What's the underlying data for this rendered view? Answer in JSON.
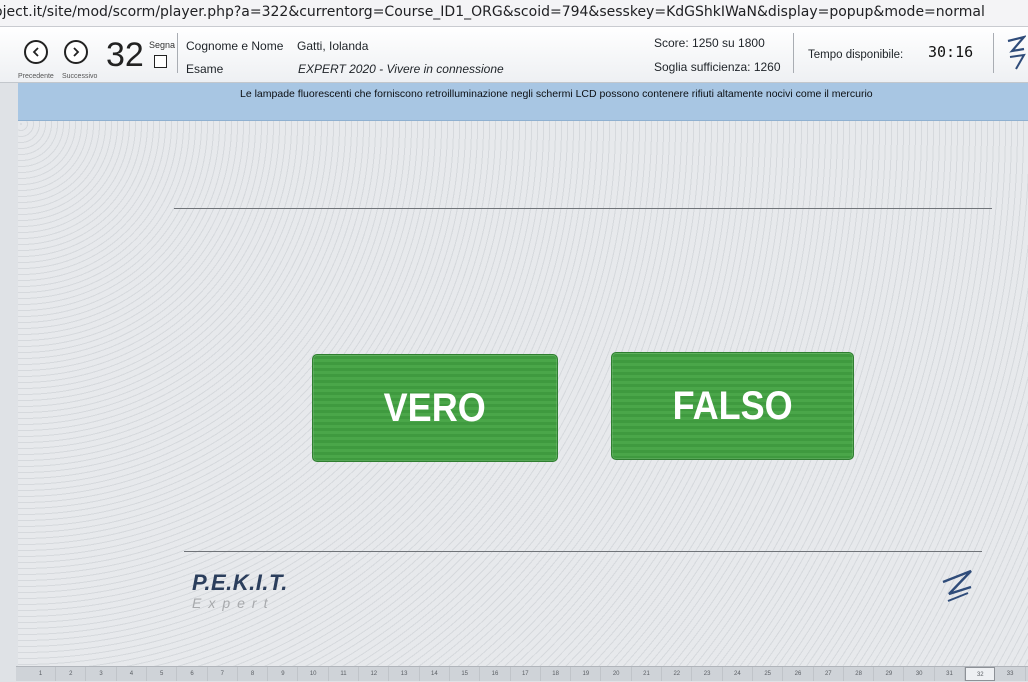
{
  "browser": {
    "url": "oject.it/site/mod/scorm/player.php?a=322&currentorg=Course_ID1_ORG&scoid=794&sesskey=KdGShkIWaN&display=popup&mode=normal"
  },
  "header": {
    "prev_label": "Precedente",
    "next_label": "Successivo",
    "question_number": "32",
    "segna_label": "Segna",
    "name_label": "Cognome e Nome",
    "name_value": "Gatti, Iolanda",
    "exam_label": "Esame",
    "exam_value": "EXPERT 2020 - Vivere in connessione",
    "score_text": "Score: 1250 su 1800",
    "threshold_text": "Soglia sufficienza: 1260",
    "time_label": "Tempo disponibile:",
    "time_value": "30:16"
  },
  "question": {
    "text": "Le lampade fluorescenti che forniscono retroilluminazione negli schermi LCD possono contenere rifiuti altamente nocivi come il mercurio"
  },
  "answers": {
    "true_label": "VERO",
    "false_label": "FALSO"
  },
  "footer": {
    "brand": "P.E.K.I.T.",
    "brand_sub": "Expert"
  },
  "progress": {
    "current": "32",
    "cells": [
      "1",
      "2",
      "3",
      "4",
      "5",
      "6",
      "7",
      "8",
      "9",
      "10",
      "11",
      "12",
      "13",
      "14",
      "15",
      "16",
      "17",
      "18",
      "19",
      "20",
      "21",
      "22",
      "23",
      "24",
      "25",
      "26",
      "27",
      "28",
      "29",
      "30",
      "31",
      "32",
      "33"
    ]
  },
  "colors": {
    "question_bar": "#a8c6e3",
    "answer_green": "#45a144",
    "brand_navy": "#2b3e5c"
  }
}
